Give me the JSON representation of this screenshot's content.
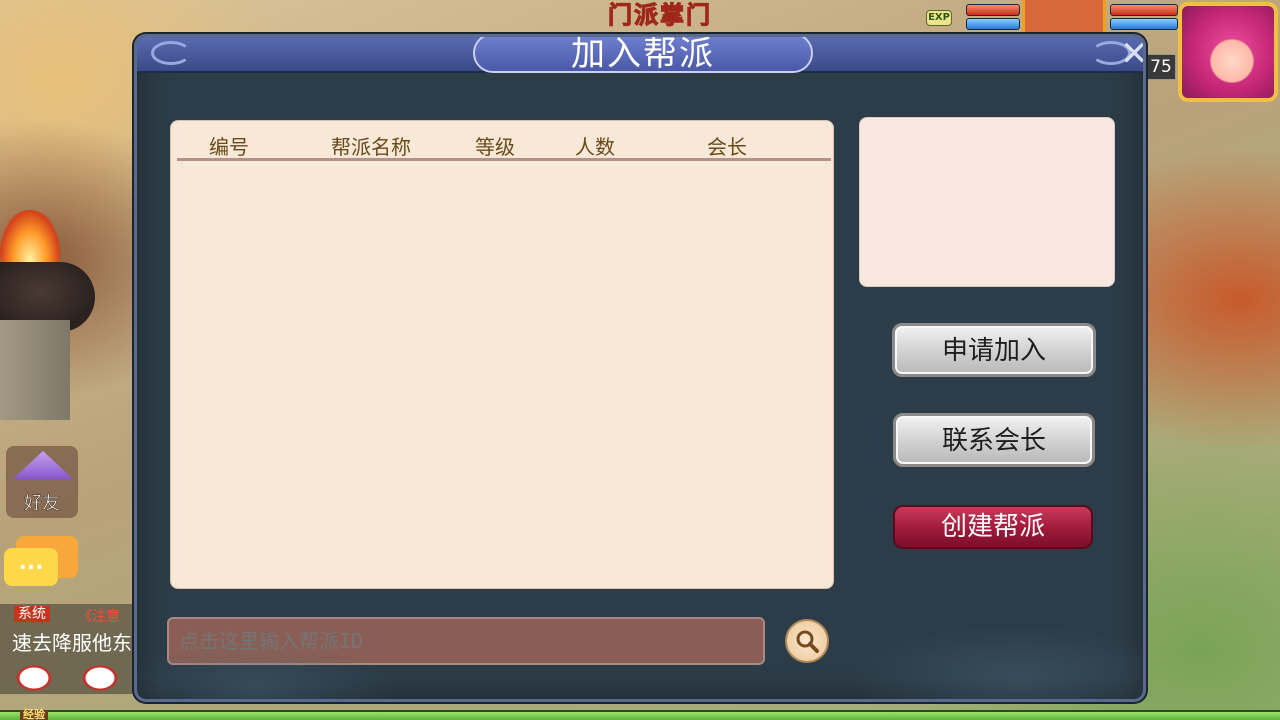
{
  "hud": {
    "event_title": "门派掌门",
    "exp_badge": "EXP",
    "level": "75"
  },
  "left": {
    "friend_label": "好友",
    "chat_icon": "...",
    "chat_system_tag": "系统",
    "chat_warning": "《注意",
    "chat_message": "速去降服他东"
  },
  "footer": {
    "exp_label": "经验"
  },
  "dialog": {
    "title": "加入帮派",
    "close_glyph": "✕",
    "columns": [
      "编号",
      "帮派名称",
      "等级",
      "人数",
      "会长"
    ],
    "search": {
      "placeholder": "点击这里输入帮派ID",
      "value": ""
    },
    "buttons": {
      "apply": "申请加入",
      "contact": "联系会长",
      "create": "创建帮派"
    }
  },
  "colors": {
    "dialog_bg": "#2c3c48",
    "header": "#4a58a8",
    "list_bg": "#f8e8d8",
    "create_button": "#a01a3a",
    "search_field": "#8a5e54"
  }
}
